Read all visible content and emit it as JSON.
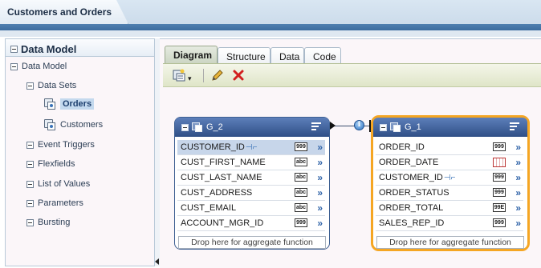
{
  "window": {
    "title": "Customers and Orders"
  },
  "sidebar": {
    "header": "Data Model",
    "tree": {
      "root": "Data Model",
      "data_sets": {
        "label": "Data Sets",
        "items": [
          "Orders",
          "Customers"
        ],
        "selected": "Orders"
      },
      "others": [
        "Event Triggers",
        "Flexfields",
        "List of Values",
        "Parameters",
        "Bursting"
      ]
    }
  },
  "tabs": [
    "Diagram",
    "Structure",
    "Data",
    "Code"
  ],
  "active_tab": "Diagram",
  "toolbar": {
    "icons": [
      "new-dataset-icon",
      "dropdown-arrow-icon",
      "edit-pencil-icon",
      "delete-x-icon"
    ]
  },
  "groups": [
    {
      "name": "G_2",
      "selected": false,
      "fields": [
        {
          "name": "CUSTOMER_ID",
          "type": "999",
          "key": true,
          "highlighted": true
        },
        {
          "name": "CUST_FIRST_NAME",
          "type": "abc"
        },
        {
          "name": "CUST_LAST_NAME",
          "type": "abc"
        },
        {
          "name": "CUST_ADDRESS",
          "type": "abc"
        },
        {
          "name": "CUST_EMAIL",
          "type": "abc"
        },
        {
          "name": "ACCOUNT_MGR_ID",
          "type": "999"
        }
      ],
      "dropzone": "Drop here for aggregate function"
    },
    {
      "name": "G_1",
      "selected": true,
      "fields": [
        {
          "name": "ORDER_ID",
          "type": "999"
        },
        {
          "name": "ORDER_DATE",
          "type": "date"
        },
        {
          "name": "CUSTOMER_ID",
          "type": "999",
          "key": true
        },
        {
          "name": "ORDER_STATUS",
          "type": "999"
        },
        {
          "name": "ORDER_TOTAL",
          "type": "99E"
        },
        {
          "name": "SALES_REP_ID",
          "type": "999"
        }
      ],
      "dropzone": "Drop here for aggregate function"
    }
  ],
  "colors": {
    "accent": "#f5a623",
    "header_blue": "#2f4f86",
    "selection": "#c4d9ee"
  }
}
